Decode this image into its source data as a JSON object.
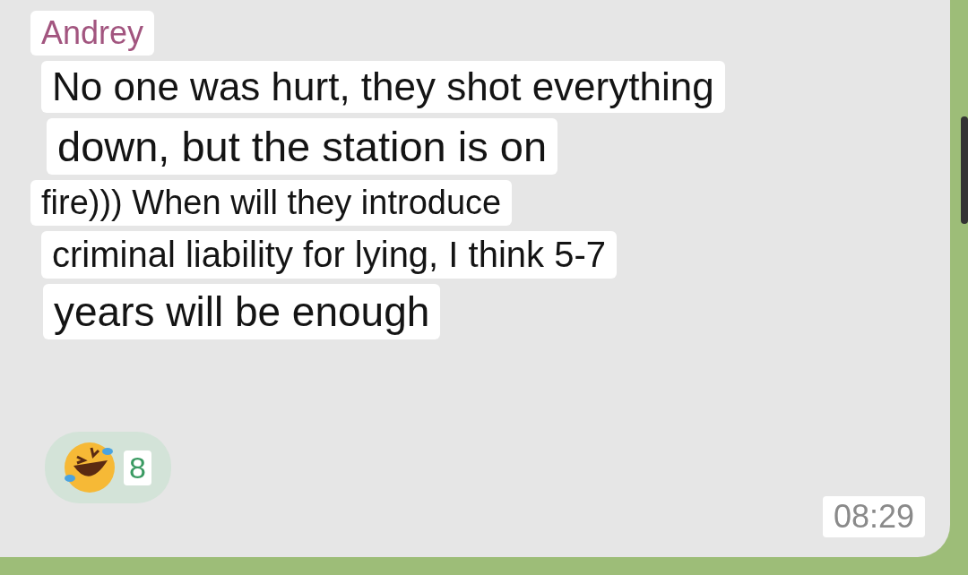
{
  "message": {
    "sender": "Andrey",
    "lines": [
      "No one was hurt, they shot everything",
      "down, but the station is on",
      "fire))) When will they introduce",
      "criminal liability for lying, I think 5-7",
      "years will be enough"
    ],
    "reaction": {
      "count": "8"
    },
    "time": "08:29"
  }
}
